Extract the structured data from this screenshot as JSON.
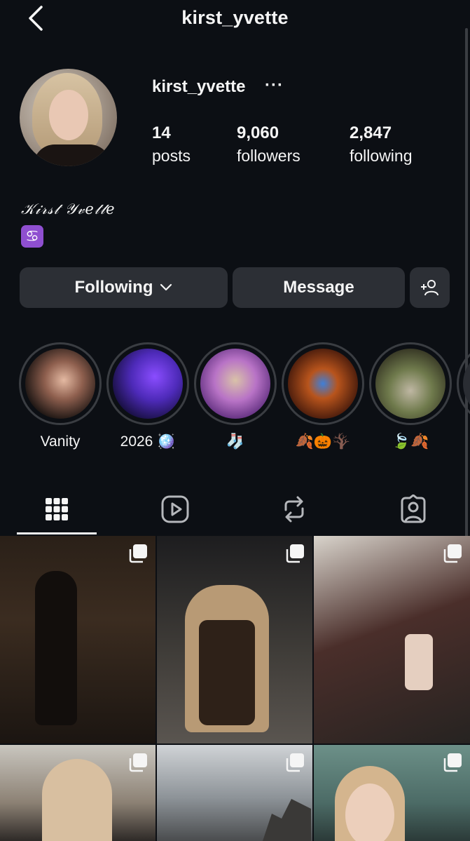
{
  "header": {
    "title": "kirst_yvette",
    "back_icon": "chevron-left-icon"
  },
  "profile": {
    "username": "kirst_yvette",
    "more_label": "···",
    "stats": [
      {
        "value": "14",
        "label": "posts"
      },
      {
        "value": "9,060",
        "label": "followers"
      },
      {
        "value": "2,847",
        "label": "following"
      }
    ],
    "full_name": "𝒦𝒾𝓇𝓈𝓉 𝒴𝓋𝑒𝓉𝓉𝑒",
    "bio_emoji": "♋"
  },
  "actions": {
    "following_label": "Following",
    "message_label": "Message",
    "add_user_icon": "add-person-icon"
  },
  "highlights": [
    {
      "label": "Vanity"
    },
    {
      "label": "2026 🪩"
    },
    {
      "label": "🧦"
    },
    {
      "label": "🍂🎃🪾"
    },
    {
      "label": "🍃🍂"
    }
  ],
  "tabs": [
    {
      "name": "grid",
      "icon": "grid-icon",
      "active": true
    },
    {
      "name": "reels",
      "icon": "reels-icon",
      "active": false
    },
    {
      "name": "reposts",
      "icon": "repost-icon",
      "active": false
    },
    {
      "name": "tagged",
      "icon": "tagged-person-icon",
      "active": false
    }
  ],
  "colors": {
    "background": "#0c0f14",
    "button": "#2c2f35",
    "text": "#f5f5f5",
    "ring": "#3a3d42"
  }
}
